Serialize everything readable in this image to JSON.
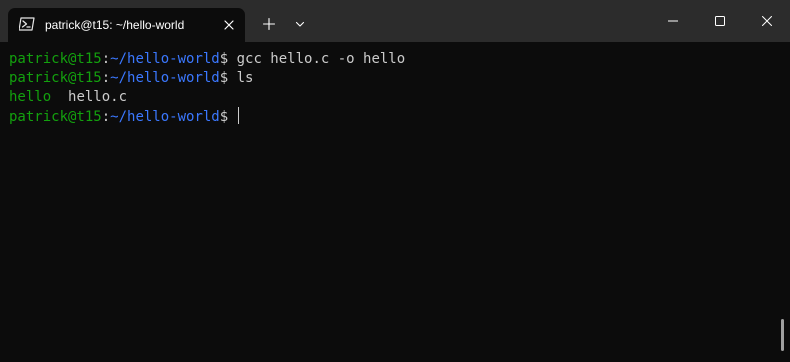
{
  "window": {
    "tab_title": "patrick@t15: ~/hello-world",
    "icons": {
      "tab": "powershell-icon",
      "tab_close": "close-icon",
      "new_tab": "plus-icon",
      "dropdown": "chevron-down-icon",
      "minimize": "minimize-icon",
      "maximize": "maximize-icon",
      "close": "close-icon"
    }
  },
  "terminal": {
    "lines": [
      {
        "user": "patrick@t15",
        "colon": ":",
        "path": "~/hello-world",
        "prompt": "$ ",
        "command": "gcc hello.c -o hello"
      },
      {
        "user": "patrick@t15",
        "colon": ":",
        "path": "~/hello-world",
        "prompt": "$ ",
        "command": "ls"
      },
      {
        "output_exec": "hello",
        "output_sep": "  ",
        "output_file": "hello.c"
      },
      {
        "user": "patrick@t15",
        "colon": ":",
        "path": "~/hello-world",
        "prompt": "$ ",
        "command": ""
      }
    ]
  },
  "colors": {
    "background": "#0c0c0c",
    "titlebar": "#2c2c2c",
    "user_green": "#13a10e",
    "path_blue": "#3b78ff",
    "text": "#cccccc"
  }
}
